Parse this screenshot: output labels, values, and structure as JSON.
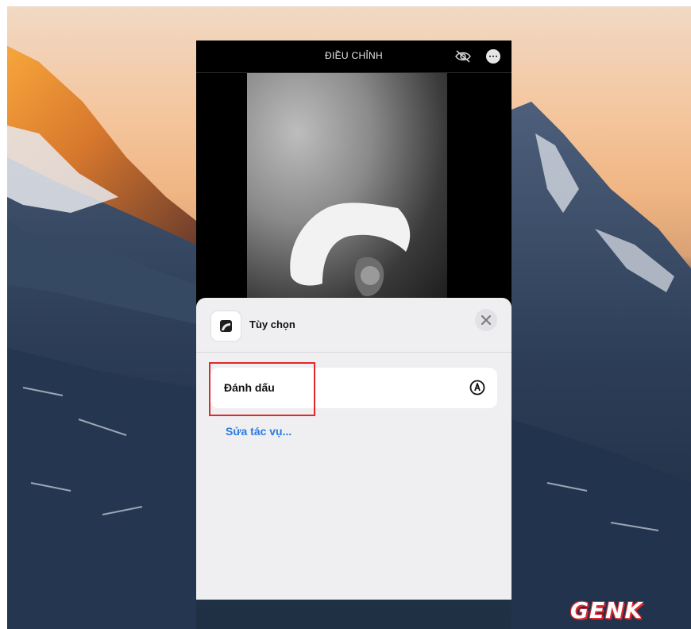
{
  "topbar": {
    "title": "ĐIỀU CHỈNH"
  },
  "sheet": {
    "title": "Tùy chọn",
    "action_label": "Đánh dấu",
    "edit_link": "Sửa tác vụ..."
  },
  "watermark": "GENK",
  "colors": {
    "highlight": "#e0282e",
    "link": "#2a7ae2"
  }
}
